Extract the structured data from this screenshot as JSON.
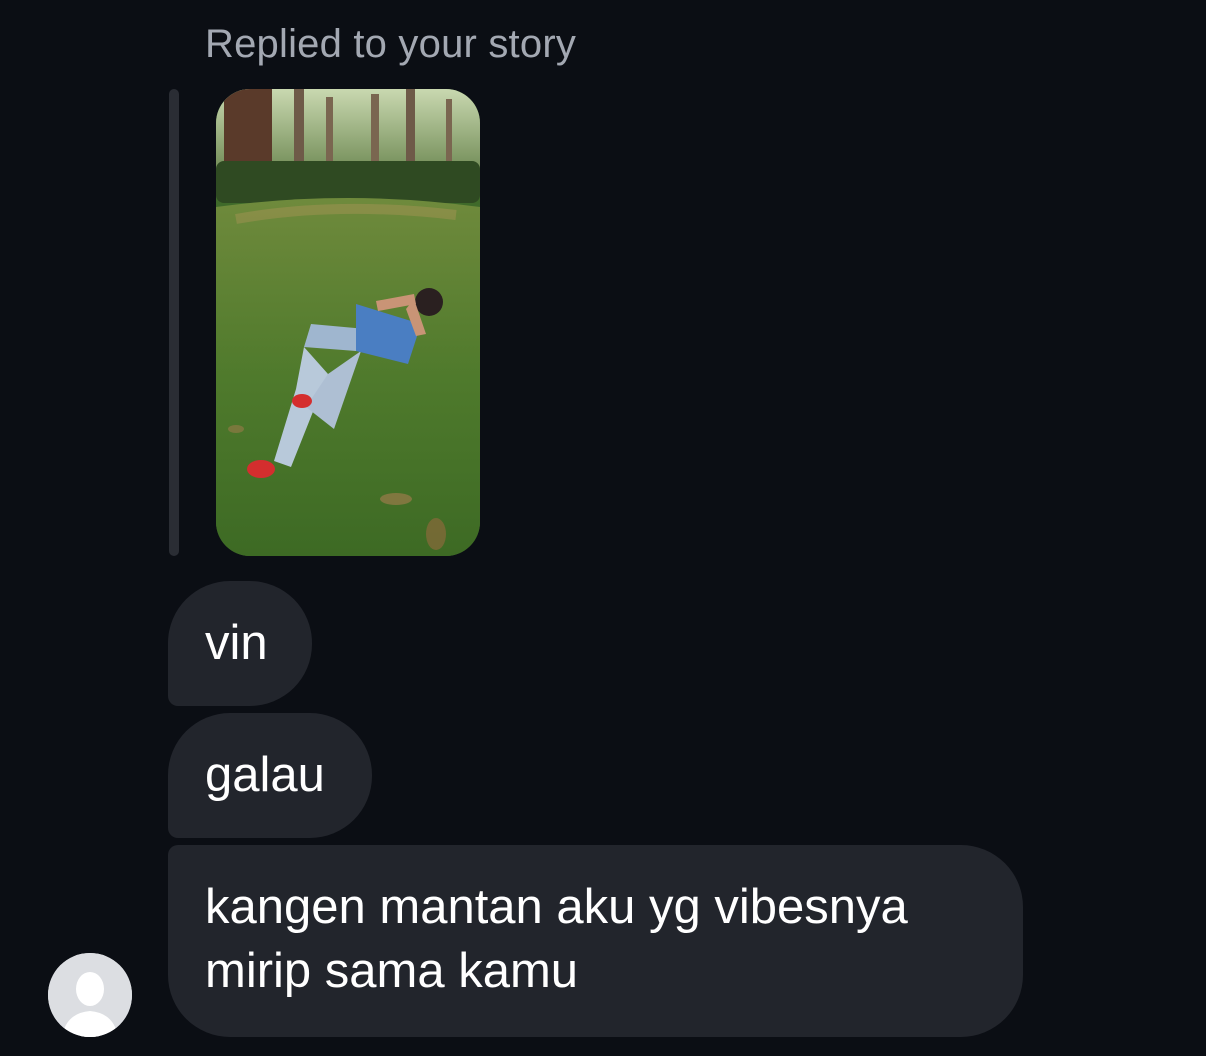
{
  "chat": {
    "reply_label": "Replied to your story",
    "messages": [
      {
        "text": "vin"
      },
      {
        "text": "galau"
      },
      {
        "text": "kangen mantan aku yg vibesnya mirip sama kamu"
      }
    ]
  },
  "icons": {
    "avatar": "default-user-silhouette-icon"
  },
  "colors": {
    "background": "#0b0e14",
    "bubble": "#22252c",
    "reply_label": "#a3a8b2",
    "reply_bar": "#2a2d34"
  }
}
